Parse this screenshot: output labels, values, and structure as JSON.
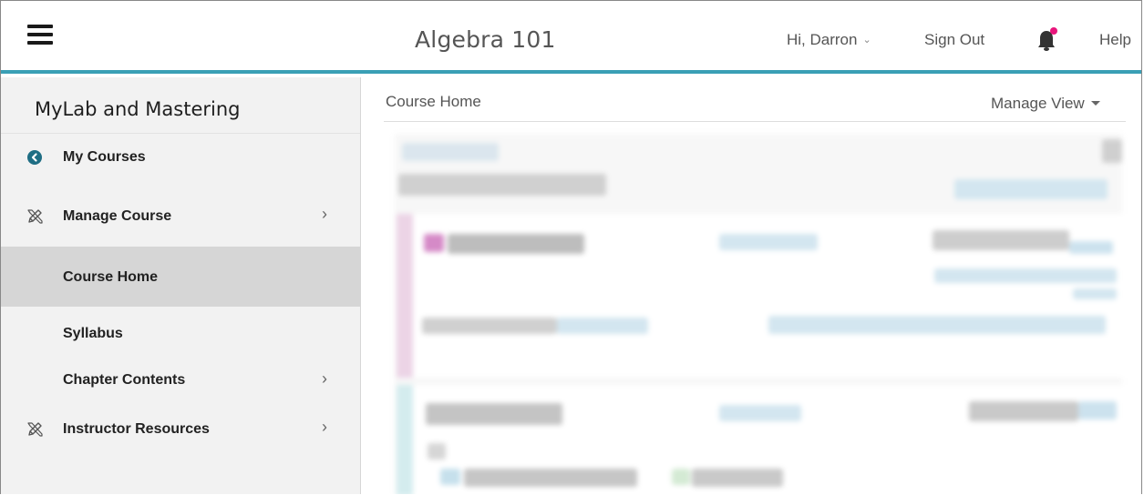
{
  "header": {
    "course_title": "Algebra 101",
    "greeting": "Hi, Darron",
    "greeting_chevron": "⌄",
    "sign_out": "Sign Out",
    "help": "Help",
    "icons": {
      "menu": "hamburger-menu-icon",
      "notifications": "bell-icon",
      "notification_dot_color": "#e8167c"
    },
    "accent_color": "#3a9fb5"
  },
  "sidebar": {
    "brand": "MyLab and Mastering",
    "items": [
      {
        "label": "My Courses",
        "icon": "back-circle-icon",
        "has_submenu": false,
        "active": false
      },
      {
        "label": "Manage Course",
        "icon": "pencil-ruler-icon",
        "has_submenu": true,
        "active": false
      },
      {
        "label": "Course Home",
        "icon": "",
        "has_submenu": false,
        "active": true
      },
      {
        "label": "Syllabus",
        "icon": "",
        "has_submenu": false,
        "active": false
      },
      {
        "label": "Chapter Contents",
        "icon": "",
        "has_submenu": true,
        "active": false
      },
      {
        "label": "Instructor Resources",
        "icon": "pencil-ruler-icon",
        "has_submenu": true,
        "active": false
      }
    ],
    "submenu_arrow": "›"
  },
  "main": {
    "breadcrumb": "Course Home",
    "manage_view": "Manage View"
  }
}
